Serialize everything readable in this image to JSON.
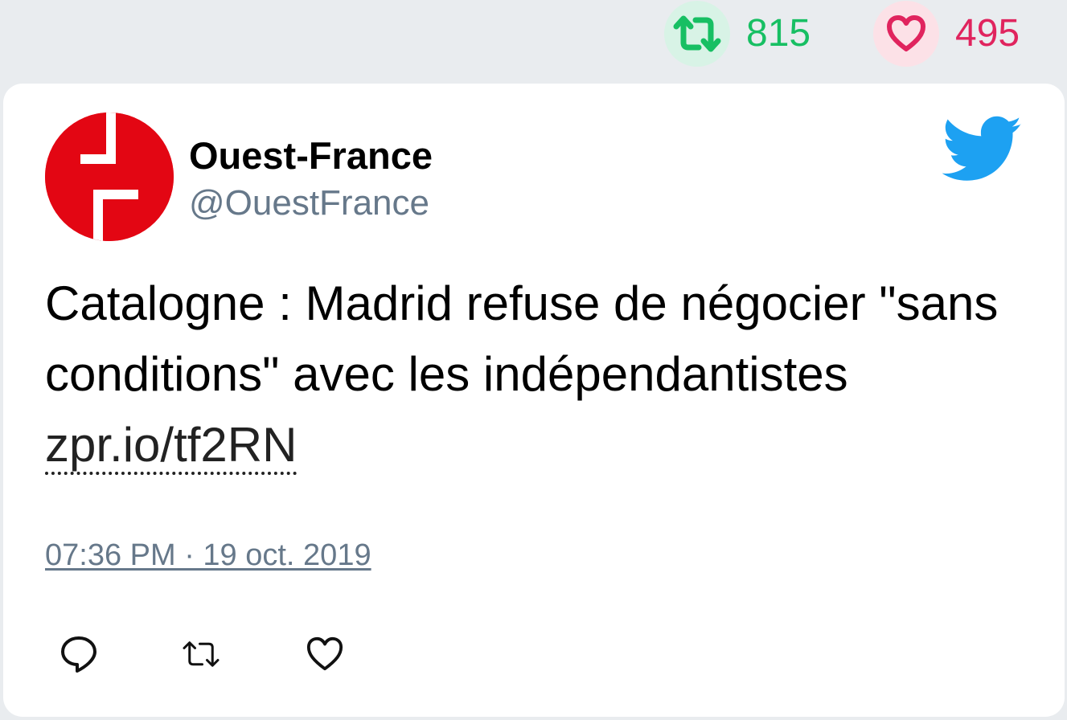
{
  "stats": {
    "retweets": "815",
    "likes": "495",
    "retweet_color": "#17bf63",
    "like_color": "#e0245e"
  },
  "tweet": {
    "author_name": "Ouest-France",
    "handle": "@OuestFrance",
    "text": "Catalogne : Madrid refuse de négocier \"sans conditions\" avec les indépendantistes ",
    "link": "zpr.io/tf2RN",
    "timestamp": "07:36 PM · 19 oct. 2019",
    "brand_color": "#e30613"
  },
  "icons": {
    "retweet_stat": "retweet-icon",
    "like_stat": "heart-icon",
    "logo": "twitter-bird-icon",
    "reply": "reply-icon",
    "retweet": "retweet-icon",
    "like": "heart-icon"
  }
}
